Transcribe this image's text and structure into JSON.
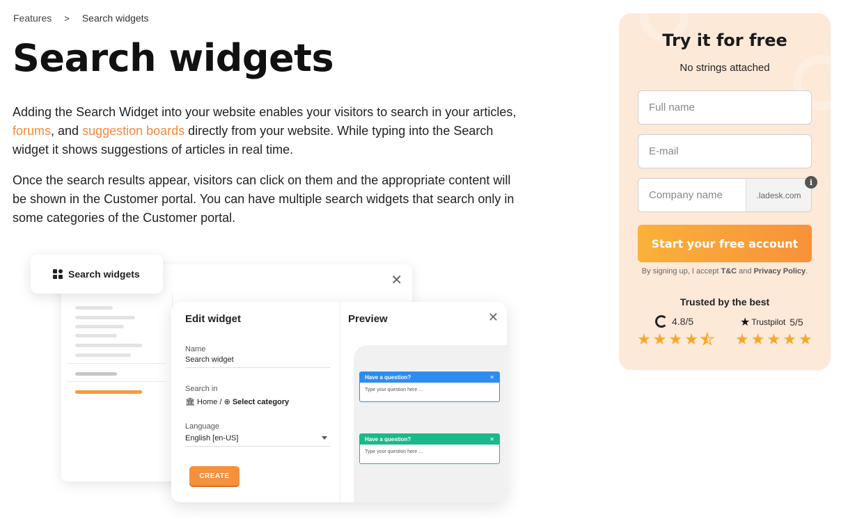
{
  "breadcrumb": {
    "items": [
      "Features",
      "Search widgets"
    ],
    "separator": ">"
  },
  "page_title": "Search widgets",
  "intro": {
    "p1_start": "Adding the Search Widget into your website enables your visitors to search in your articles, ",
    "link_forums": "forums",
    "p1_mid": ", and ",
    "link_suggestion_boards": "suggestion boards",
    "p1_end": " directly from your website. While typing into the Search widget it shows suggestions of articles in real time.",
    "p2": "Once the search results appear, visitors can click on them and the appropriate content will be shown in the Customer portal. You can have multiple search widgets that search only in some categories of the Customer portal."
  },
  "illustration": {
    "tab_label": "Search widgets",
    "close_symbol": "✕",
    "edit_title": "Edit widget",
    "name_label": "Name",
    "name_value": "Search widget",
    "search_in_label": "Search in",
    "search_in_home": "Home",
    "search_in_separator": "/",
    "search_in_select": "Select category",
    "language_label": "Language",
    "language_value": "English [en-US]",
    "create_label": "CREATE",
    "preview_title": "Preview",
    "widgets": [
      {
        "header": "Have a question?",
        "placeholder": "Type your question here ...",
        "color": "#2d8cf0"
      },
      {
        "header": "Have a question?",
        "placeholder": "Type your question here ...",
        "color": "#19b98a"
      }
    ]
  },
  "signup": {
    "title": "Try it for free",
    "subtitle": "No strings attached",
    "full_name_placeholder": "Full name",
    "email_placeholder": "E-mail",
    "company_placeholder": "Company name",
    "company_suffix": ".ladesk.com",
    "info_symbol": "i",
    "start_button": "Start your free account",
    "terms_prefix": "By signing up, I accept ",
    "terms_link": "T&C",
    "terms_mid": " and ",
    "privacy_link": "Privacy Policy",
    "terms_suffix": ".",
    "trusted": "Trusted by the best",
    "g2_rating": "4.8/5",
    "trustpilot_name": "Trustpilot",
    "trustpilot_rating": "5/5",
    "g2_stars": 4.5,
    "trustpilot_stars": 5
  },
  "colors": {
    "accent": "#f3893d",
    "card_bg": "#fde9d8",
    "star": "#f7a823"
  }
}
